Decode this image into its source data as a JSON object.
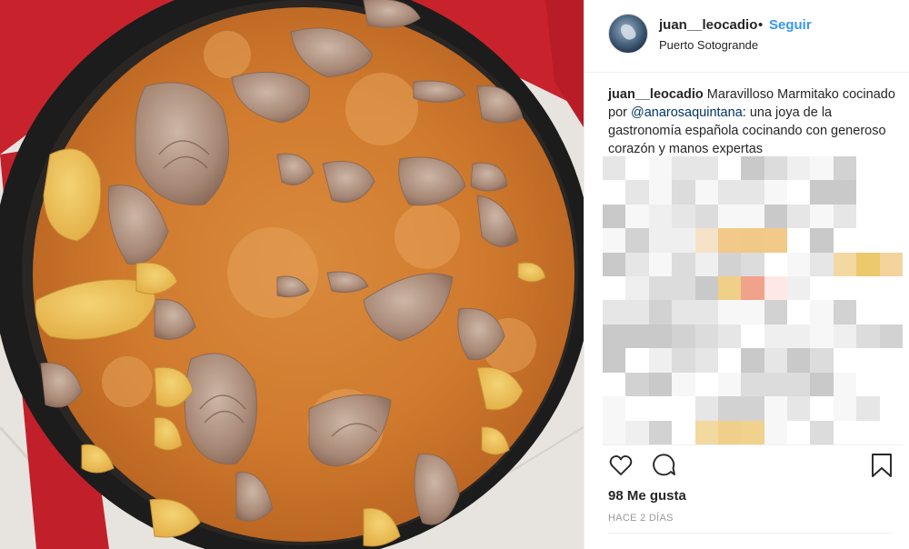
{
  "post": {
    "username": "juan__leocadio",
    "follow_label": "Seguir",
    "location": "Puerto Sotogrande",
    "caption": {
      "user": "juan__leocadio",
      "text_before": "Maravilloso Marmitako cocinado por ",
      "mention": "@anarosaquintana",
      "text_after": ": una joya de la gastronomía española cocinando con generoso corazón y manos expertas"
    },
    "likes": "98 Me gusta",
    "timestamp": "HACE 2 DÍAS"
  },
  "icons": {
    "like": "heart-icon",
    "comment": "comment-icon",
    "save": "bookmark-icon"
  },
  "colors": {
    "link_blue": "#3897f0",
    "mention_navy": "#003569",
    "stew_orange": "#d07a2e",
    "pot_rim": "#1c1c1c",
    "placemat_red": "#c8232c"
  }
}
